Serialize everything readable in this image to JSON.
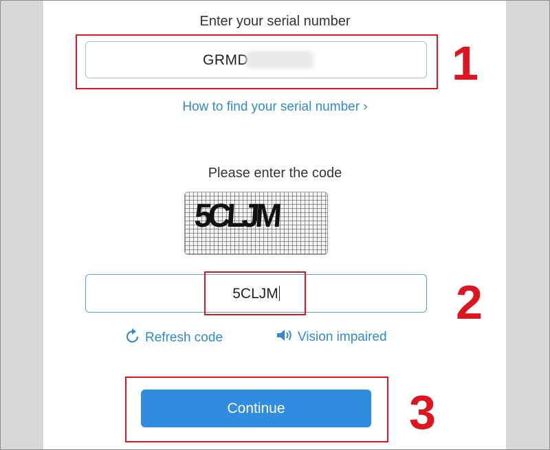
{
  "serial": {
    "label": "Enter your serial number",
    "value": "GRMD",
    "help_link": "How to find your serial number ›"
  },
  "captcha": {
    "label": "Please enter the code",
    "image_text": "5CLJM",
    "input_value": "5CLJM",
    "refresh_label": "Refresh code",
    "refresh_icon": "refresh-icon",
    "vision_label": "Vision impaired",
    "vision_icon": "speaker-icon"
  },
  "actions": {
    "continue_label": "Continue"
  },
  "annotations": {
    "step1": "1",
    "step2": "2",
    "step3": "3",
    "color": "#e0141e"
  },
  "colors": {
    "link": "#2e8bd0",
    "button": "#2f8cdf",
    "background": "#d8d8d8"
  }
}
